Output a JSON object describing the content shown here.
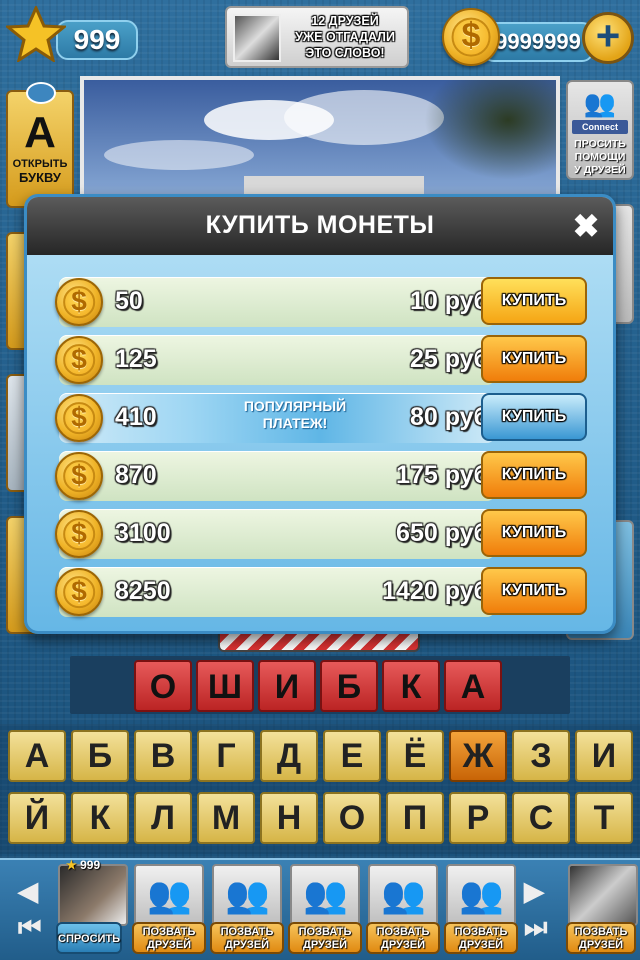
{
  "top_bar": {
    "stars": "999",
    "friends_text_lines": [
      "12 ДРУЗЕЙ",
      "УЖЕ ОТГАДАЛИ",
      "ЭТО СЛОВО!"
    ],
    "coins": "9999999",
    "plus_symbol": "+"
  },
  "left_hints": {
    "open_letter_glyph": "A",
    "open_letter_lines": [
      "ОТКРЫТЬ",
      "БУКВУ"
    ]
  },
  "right_hints": {
    "connect_label": "Connect",
    "ask_help_lines": [
      "ПРОСИТЬ",
      "ПОМОЩИ",
      "У ДРУЗЕЙ"
    ]
  },
  "modal": {
    "title": "КУПИТЬ МОНЕТЫ",
    "close_symbol": "✖",
    "coin_symbol": "$",
    "rows": [
      {
        "amount": "50",
        "price": "10 руб",
        "buy": "КУПИТЬ",
        "style": "yellow"
      },
      {
        "amount": "125",
        "price": "25 руб",
        "buy": "КУПИТЬ",
        "style": "orange"
      },
      {
        "amount": "410",
        "price": "80 руб",
        "buy": "КУПИТЬ",
        "style": "blue",
        "popular_lines": [
          "ПОПУЛЯРНЫЙ",
          "ПЛАТЕЖ!"
        ]
      },
      {
        "amount": "870",
        "price": "175 руб",
        "buy": "КУПИТЬ",
        "style": "orange"
      },
      {
        "amount": "3100",
        "price": "650 руб",
        "buy": "КУПИТЬ",
        "style": "orange"
      },
      {
        "amount": "8250",
        "price": "1420 руб",
        "buy": "КУПИТЬ",
        "style": "orange"
      }
    ]
  },
  "answer": {
    "letters": [
      "О",
      "Ш",
      "И",
      "Б",
      "К",
      "А"
    ]
  },
  "keyboard": {
    "row1": [
      "А",
      "Б",
      "В",
      "Г",
      "Д",
      "Е",
      "Ё",
      "Ж",
      "З",
      "И"
    ],
    "row2": [
      "Й",
      "К",
      "Л",
      "М",
      "Н",
      "О",
      "П",
      "Р",
      "С",
      "Т"
    ],
    "highlighted": "Ж"
  },
  "bottom_bar": {
    "self_score": "999",
    "ask_label": "СПРОСИТЬ",
    "call_label_lines": [
      "ПОЗВАТЬ",
      "ДРУЗЕЙ"
    ],
    "prev_arrow": "◀",
    "next_arrow": "▶"
  }
}
